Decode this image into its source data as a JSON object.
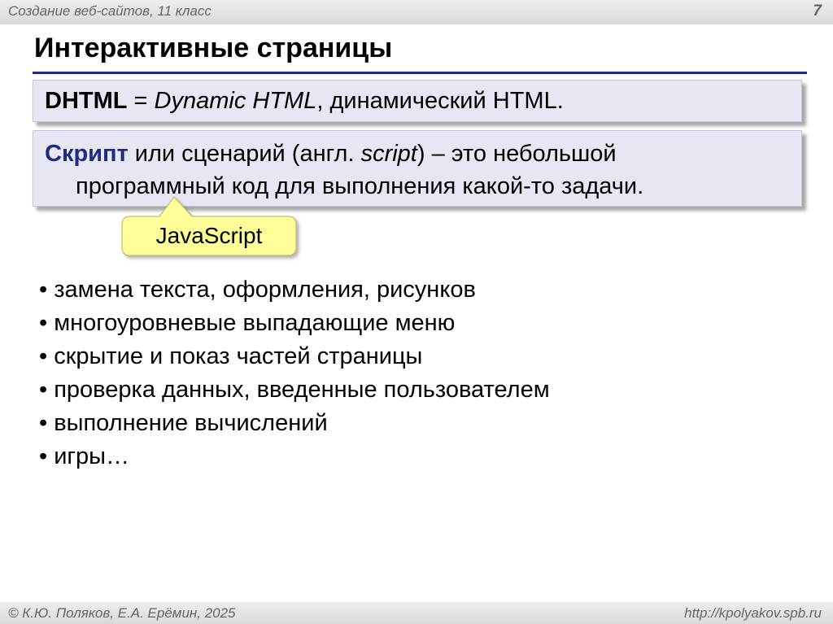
{
  "header": {
    "course": "Создание веб-сайтов, 11 класс",
    "page_number": "7"
  },
  "title": "Интерактивные страницы",
  "definition_dhtml": {
    "term": "DHTML",
    "eq": " = ",
    "expansion": "Dynamic HTML",
    "rest": ", динамический HTML."
  },
  "definition_script": {
    "term": "Скрипт",
    "part1": " или сценарий (англ. ",
    "eng": "script",
    "part2": ") – это небольшой",
    "line2": "программный код для выполнения какой-то задачи."
  },
  "callout": {
    "label": "JavaScript",
    "fill": "#ffff99",
    "stroke": "#b3b36b"
  },
  "bullets": [
    "замена текста, оформления, рисунков",
    "многоуровневые выпадающие меню",
    "скрытие и показ частей страницы",
    "проверка данных, введенные пользователем",
    "выполнение вычислений",
    "игры…"
  ],
  "footer": {
    "authors": "© К.Ю. Поляков, Е.А. Ерёмин, 2025",
    "site": "http://kpolyakov.spb.ru"
  },
  "colors": {
    "accent": "#1c2b88",
    "box_bg": "#e6e7f2"
  }
}
